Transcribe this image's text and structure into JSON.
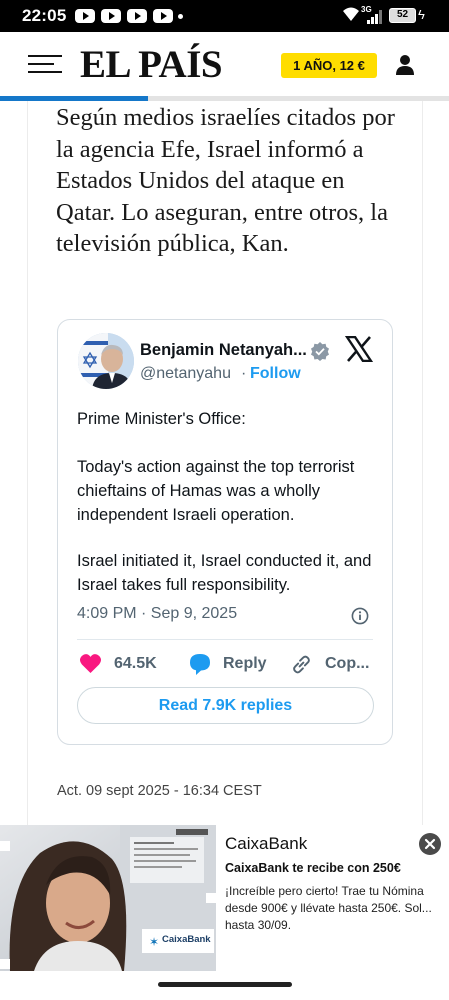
{
  "status_bar": {
    "time": "22:05",
    "network_label": "3G",
    "battery_level": "52",
    "icons": [
      "youtube-icon",
      "youtube-icon",
      "youtube-icon",
      "youtube-icon",
      "wifi-icon",
      "signal-icon",
      "battery-icon",
      "charging-icon"
    ]
  },
  "header": {
    "logo": "EL PAÍS",
    "subscribe_label": "1 AÑO, 12 €",
    "menu_icon": "hamburger-icon",
    "account_icon": "user-icon",
    "accent_color": "#ffdd00",
    "reading_progress": 0.33,
    "progress_color": "#1577c9"
  },
  "article": {
    "paragraph": "Según medios israelíes citados por la agencia Efe, Israel informó a Estados Unidos del ataque en Qatar. Lo aseguran, entre otros, la televisión pública, Kan.",
    "update_time": "Act. 09 sept 2025 - 16:34 CEST"
  },
  "tweet": {
    "author_name": "Benjamin Netanyah...",
    "handle": "@netanyahu",
    "separator": "·",
    "follow_label": "Follow",
    "paragraphs": [
      "Prime Minister's Office:",
      "Today's action against the top terrorist chieftains of Hamas was a wholly independent Israeli operation.",
      "Israel initiated it, Israel conducted it, and Israel takes full responsibility."
    ],
    "timestamp": "4:09 PM · Sep 9, 2025",
    "likes": "64.5K",
    "reply_label": "Reply",
    "copy_label": "Cop...",
    "read_replies_label": "Read 7.9K replies",
    "link_color": "#1d9bf0",
    "like_color": "#f91880"
  },
  "ad": {
    "brand": "CaixaBank",
    "headline": "CaixaBank te recibe con 250€",
    "body": "¡Increíble pero cierto! Trae tu Nómina desde 900€ y llévate hasta 250€. Sol... hasta 30/09.",
    "image_logo_text": "CaixaBank",
    "close_icon": "close-icon"
  }
}
